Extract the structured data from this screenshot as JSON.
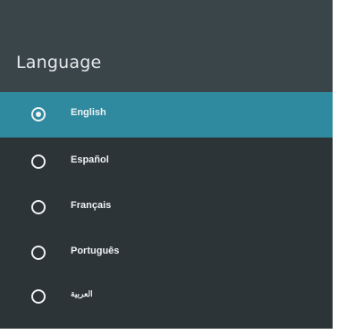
{
  "header": {
    "title": "Language"
  },
  "languages": [
    {
      "label": "English",
      "selected": true
    },
    {
      "label": "Español",
      "selected": false
    },
    {
      "label": "Français",
      "selected": false
    },
    {
      "label": "Português",
      "selected": false
    },
    {
      "label": "العربية",
      "selected": false
    }
  ],
  "colors": {
    "panel_bg": "#2c3437",
    "header_bg": "#3a4549",
    "selected_bg": "#2f8aa0",
    "text": "#eef2f3"
  }
}
